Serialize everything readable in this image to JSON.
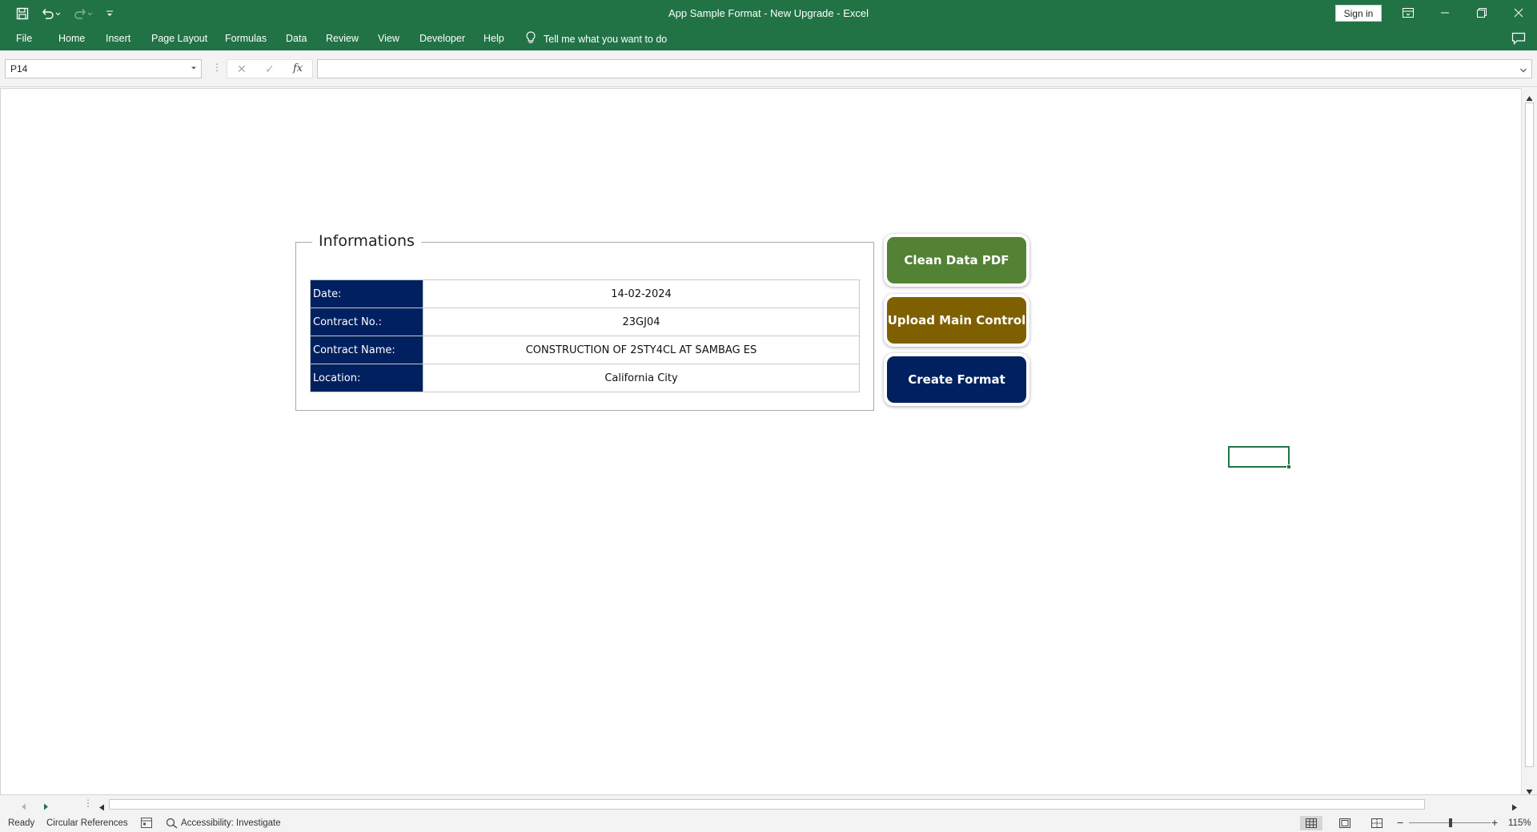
{
  "window": {
    "title": "App Sample Format - New Upgrade  -  Excel",
    "sign_in": "Sign in"
  },
  "ribbon": {
    "tabs": [
      "File",
      "Home",
      "Insert",
      "Page Layout",
      "Formulas",
      "Data",
      "Review",
      "View",
      "Developer",
      "Help"
    ],
    "tell_me": "Tell me what you want to do"
  },
  "formula_bar": {
    "name_box": "P14",
    "cancel": "✕",
    "enter": "✓",
    "fx": "fx",
    "formula": ""
  },
  "sheet": {
    "group_title": "Informations",
    "rows": [
      {
        "label": "Date:",
        "value": "14-02-2024"
      },
      {
        "label": "Contract No.:",
        "value": "23GJ04"
      },
      {
        "label": "Contract Name:",
        "value": "CONSTRUCTION OF 2STY4CL AT SAMBAG ES"
      },
      {
        "label": "Location:",
        "value": "California City"
      }
    ],
    "buttons": [
      {
        "label": "Clean Data PDF",
        "color": "#548235"
      },
      {
        "label": "Upload Main Control",
        "color": "#7f6000"
      },
      {
        "label": "Create Format",
        "color": "#002060"
      }
    ],
    "label_bg": "#002060"
  },
  "status": {
    "ready": "Ready",
    "circular": "Circular References",
    "accessibility": "Accessibility: Investigate",
    "zoom": "115%"
  },
  "theme": {
    "excel_green": "#217346"
  }
}
